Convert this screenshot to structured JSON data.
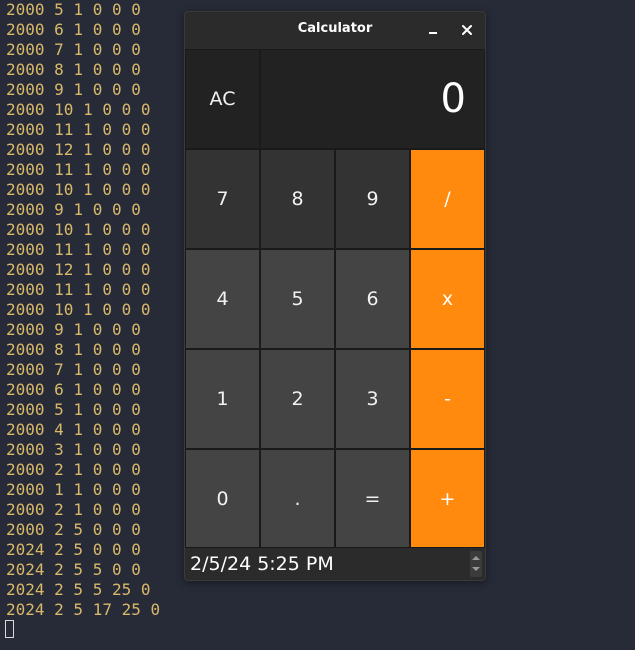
{
  "terminal": {
    "lines": [
      "2000 5 1 0 0 0",
      "2000 6 1 0 0 0",
      "2000 7 1 0 0 0",
      "2000 8 1 0 0 0",
      "2000 9 1 0 0 0",
      "2000 10 1 0 0 0",
      "2000 11 1 0 0 0",
      "2000 12 1 0 0 0",
      "2000 11 1 0 0 0",
      "2000 10 1 0 0 0",
      "2000 9 1 0 0 0",
      "2000 10 1 0 0 0",
      "2000 11 1 0 0 0",
      "2000 12 1 0 0 0",
      "2000 11 1 0 0 0",
      "2000 10 1 0 0 0",
      "2000 9 1 0 0 0",
      "2000 8 1 0 0 0",
      "2000 7 1 0 0 0",
      "2000 6 1 0 0 0",
      "2000 5 1 0 0 0",
      "2000 4 1 0 0 0",
      "2000 3 1 0 0 0",
      "2000 2 1 0 0 0",
      "2000 1 1 0 0 0",
      "2000 2 1 0 0 0",
      "2000 2 5 0 0 0",
      "2024 2 5 0 0 0",
      "2024 2 5 5 0 0",
      "2024 2 5 5 25 0",
      "2024 2 5 17 25 0"
    ]
  },
  "calculator": {
    "title": "Calculator",
    "minimize_icon": "minimize-icon",
    "close_label": "×",
    "display_value": "0",
    "keys": {
      "ac": "AC",
      "seven": "7",
      "eight": "8",
      "nine": "9",
      "divide": "/",
      "four": "4",
      "five": "5",
      "six": "6",
      "multiply": "x",
      "one": "1",
      "two": "2",
      "three": "3",
      "subtract": "-",
      "zero": "0",
      "decimal": ".",
      "equals": "=",
      "add": "+"
    },
    "datetime": "2/5/24 5:25 PM",
    "colors": {
      "operator": "#ff8a0d",
      "digit_top_row": "#333333",
      "digit": "#444444",
      "terminal_text": "#d9b86a",
      "terminal_bg": "#262b37"
    }
  }
}
